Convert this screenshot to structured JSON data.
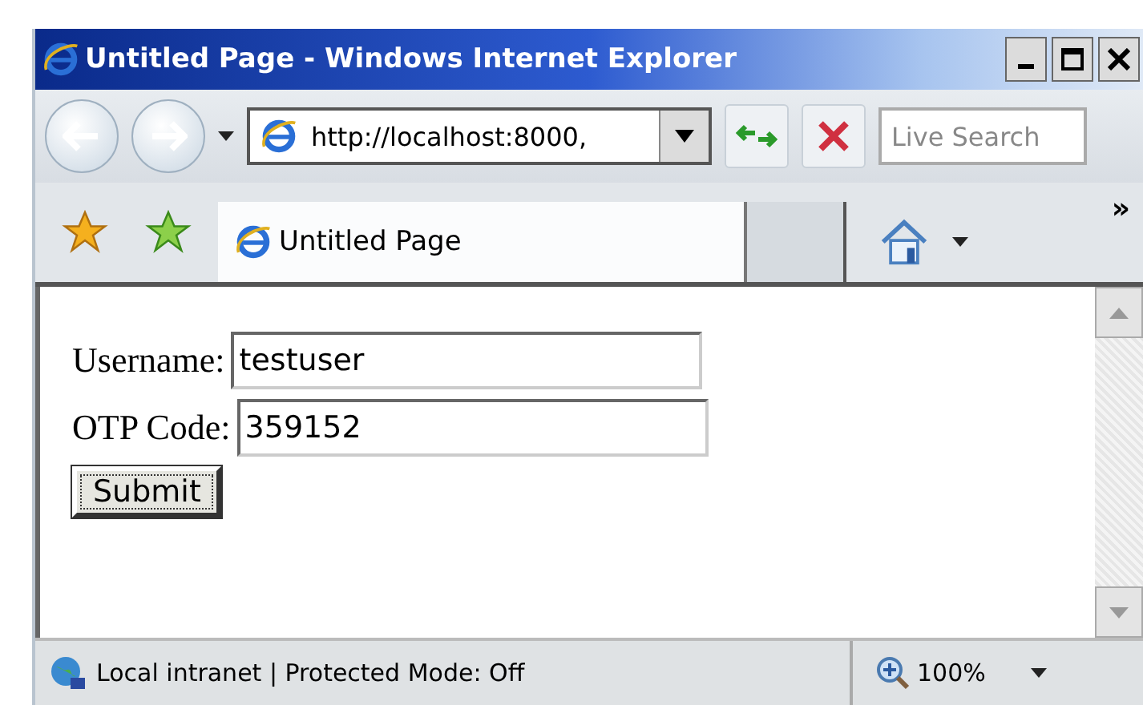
{
  "window": {
    "title": "Untitled Page - Windows Internet Explorer"
  },
  "address": {
    "url": "http://localhost:8000,"
  },
  "search": {
    "placeholder": "Live Search"
  },
  "tabs": [
    {
      "label": "Untitled Page",
      "selected": true
    }
  ],
  "toolbar": {
    "overflow": "»"
  },
  "form": {
    "fields": [
      {
        "label": "Username:",
        "value": "testuser"
      },
      {
        "label": "OTP Code:",
        "value": "359152"
      }
    ],
    "submit": "Submit"
  },
  "status_bar": {
    "zone": "Local intranet | Protected Mode: Off",
    "zoom": "100%"
  }
}
